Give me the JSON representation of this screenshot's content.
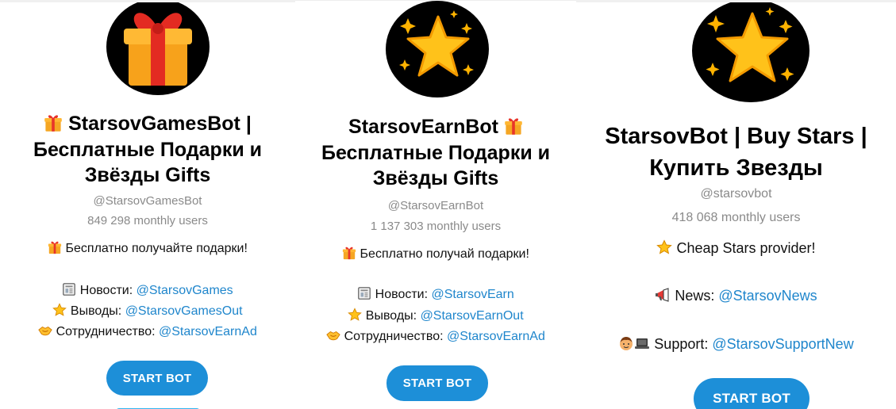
{
  "cards": [
    {
      "avatar_icon": "gift-box-icon",
      "title_line1": "StarsovGamesBot |",
      "title_line2": "Бесплатные Подарки и",
      "title_line3": "Звёзды Gifts",
      "handle": "@StarsovGamesBot",
      "monthly_users": "849 298 monthly users",
      "description": "Бесплатно получайте подарки!",
      "news_label": "Новости: ",
      "news_link": "@StarsovGames",
      "withdrawals_label": "Выводы: ",
      "withdrawals_link": "@StarsovGamesOut",
      "coop_label": "Сотрудничество: ",
      "coop_link": "@StarsovEarnAd",
      "button_label": "START BOT"
    },
    {
      "avatar_icon": "sparkle-star-icon",
      "title_line1": "StarsovEarnBot",
      "title_line2": "Бесплатные Подарки и",
      "title_line3": "Звёзды Gifts",
      "handle": "@StarsovEarnBot",
      "monthly_users": "1 137 303 monthly users",
      "description": "Бесплатно получай подарки!",
      "news_label": "Новости: ",
      "news_link": "@StarsovEarn",
      "withdrawals_label": "Выводы: ",
      "withdrawals_link": "@StarsovEarnOut",
      "coop_label": "Сотрудничество: ",
      "coop_link": "@StarsovEarnAd",
      "button_label": "START BOT"
    },
    {
      "avatar_icon": "sparkle-star-icon",
      "title_line1": "StarsovBot | Buy Stars |",
      "title_line2": "Купить Звезды",
      "handle": "@starsovbot",
      "monthly_users": "418 068 monthly users",
      "description": "Cheap Stars provider!",
      "news_label": "News: ",
      "news_link": "@StarsovNews",
      "support_label": "Support: ",
      "support_link": "@StarsovSupportNew",
      "button_label": "START BOT"
    }
  ],
  "colors": {
    "link": "#1f86cc",
    "button": "#1d8fd8",
    "muted": "#8a8a8a"
  }
}
